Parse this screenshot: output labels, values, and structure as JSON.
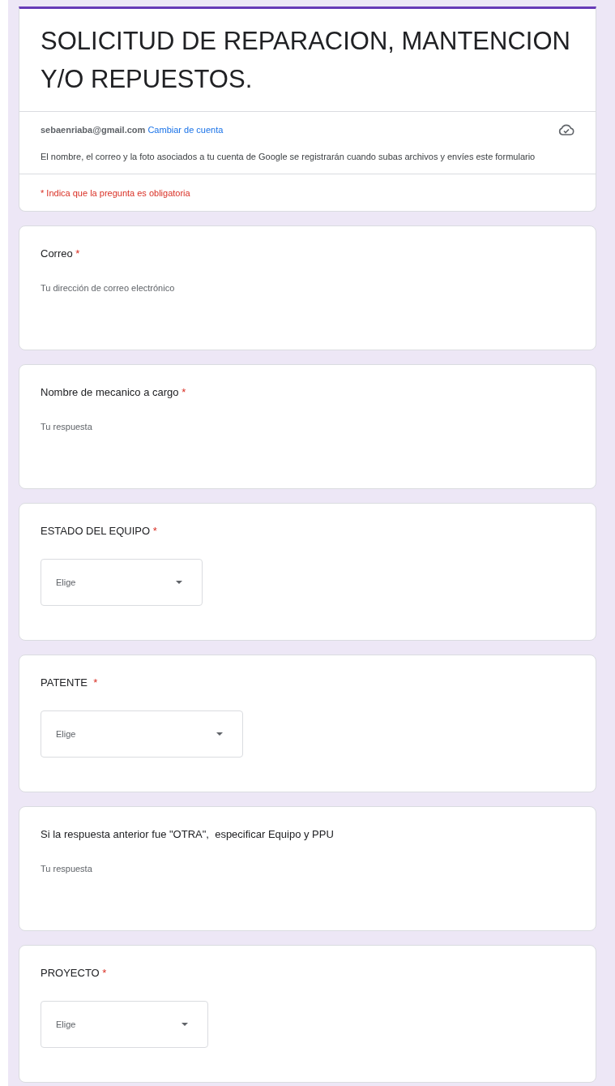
{
  "header": {
    "title": "SOLICITUD DE REPARACION, MANTENCION Y/O REPUESTOS.",
    "account_email": "sebaenriaba@gmail.com",
    "switch_account_link": "Cambiar de cuenta",
    "notice": "El nombre, el correo y la foto asociados a tu cuenta de Google se registrarán cuando subas archivos y envíes este formulario",
    "required_note": "* Indica que la pregunta es obligatoria"
  },
  "questions": [
    {
      "kind": "text",
      "label": "Correo",
      "asterisk": "*",
      "placeholder": "Tu dirección de correo electrónico"
    },
    {
      "kind": "text",
      "label": "Nombre de mecanico a cargo",
      "asterisk": "*",
      "placeholder": "Tu respuesta"
    },
    {
      "kind": "dropdown",
      "label": "ESTADO DEL EQUIPO",
      "asterisk": "*",
      "placeholder": "Elige"
    },
    {
      "kind": "dropdown",
      "label": "PATENTE ",
      "asterisk": "*",
      "placeholder": "Elige"
    },
    {
      "kind": "text",
      "label": "Si la respuesta anterior fue \"OTRA\",  especificar Equipo y PPU",
      "placeholder": "Tu respuesta"
    },
    {
      "kind": "dropdown",
      "label": "PROYECTO",
      "asterisk": "*",
      "placeholder": "Elige"
    }
  ]
}
